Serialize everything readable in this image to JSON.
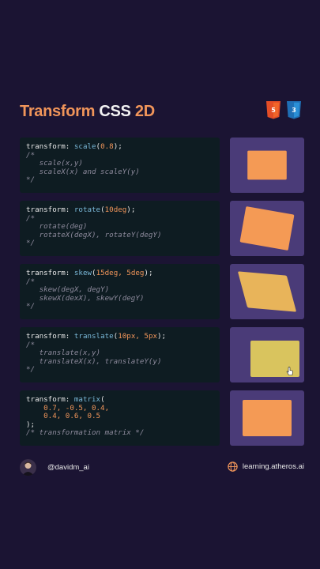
{
  "title": {
    "part1": "Transform",
    "part2": "CSS",
    "part3": "2D"
  },
  "logos": {
    "html_icon": "html5-icon",
    "css_icon": "css3-icon",
    "html_color": "#e44d26",
    "css_color": "#2a8fd6"
  },
  "examples": [
    {
      "fn": "scale",
      "args": "0.8",
      "comment_lines": [
        "scale(x,y)",
        "scaleX(x) and scaleY(y)"
      ],
      "transform_css": "scale(0.8)",
      "box_color": "#f49a55"
    },
    {
      "fn": "rotate",
      "args": "10deg",
      "comment_lines": [
        "rotate(deg)",
        "rotateX(degX), rotateY(degY)"
      ],
      "transform_css": "rotate(10deg)",
      "box_color": "#f49a55"
    },
    {
      "fn": "skew",
      "args": "15deg, 5deg",
      "comment_lines": [
        "skew(degX, degY)",
        "skewX(dexX), skewY(degY)"
      ],
      "transform_css": "skew(15deg, 5deg)",
      "box_color": "#e8b45a"
    },
    {
      "fn": "translate",
      "args": "10px, 5px",
      "comment_lines": [
        "translate(x,y)",
        "translateX(x), translateY(y)"
      ],
      "transform_css": "translate(10px, 5px)",
      "box_color": "#d9c45e"
    },
    {
      "fn": "matrix",
      "args_lines": [
        "0.7, -0.5, 0.4,",
        "0.4, 0.6, 0.5"
      ],
      "closing": ");",
      "comment": "/* transformation matrix */",
      "transform_css": "none",
      "box_color": "#f49a55"
    }
  ],
  "code_tokens": {
    "keyword": "transform:",
    "comment_open": "/*",
    "comment_close": "*/"
  },
  "footer": {
    "handle": "@davidm_ai",
    "site": "learning.atheros.ai",
    "site_icon": "globe-icon"
  },
  "colors": {
    "background": "#1b1433",
    "code_bg": "#0e1c22",
    "demo_bg": "#4a3b78",
    "accent": "#f0955a"
  }
}
